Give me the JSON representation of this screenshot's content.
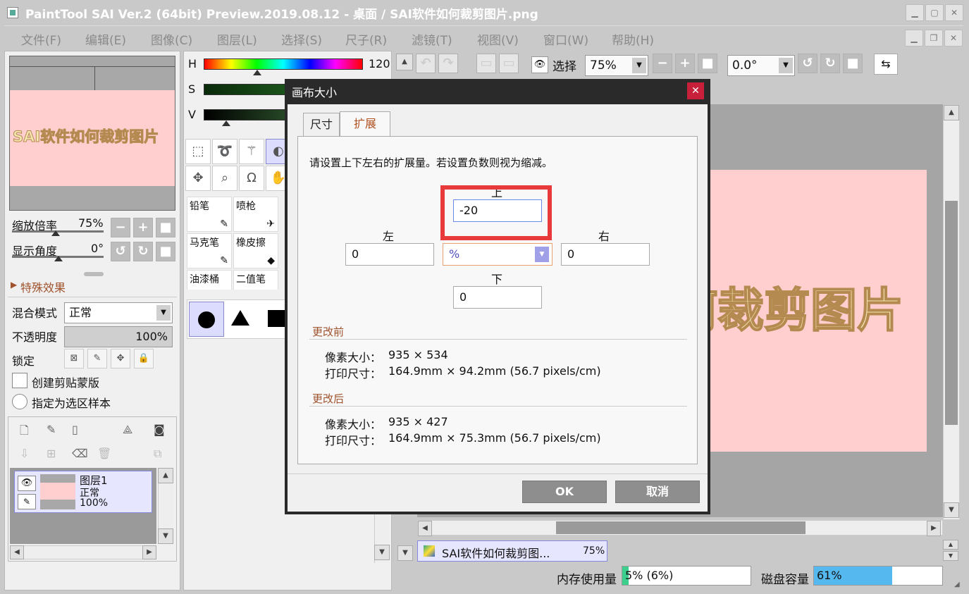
{
  "window": {
    "title": "PaintTool SAI Ver.2 (64bit) Preview.2019.08.12 - 桌面 / SAI软件如何裁剪图片.png"
  },
  "menu": [
    "文件(F)",
    "编辑(E)",
    "图像(C)",
    "图层(L)",
    "选择(S)",
    "尺子(R)",
    "滤镜(T)",
    "视图(V)",
    "窗口(W)",
    "帮助(H)"
  ],
  "navigator": {
    "preview_text": "SAI软件如何裁剪图片",
    "zoom_label": "缩放倍率",
    "zoom_value": "75%",
    "angle_label": "显示角度",
    "angle_value": "0°"
  },
  "effects_label": "特殊效果",
  "layer_props": {
    "blend_label": "混合模式",
    "blend_value": "正常",
    "opacity_label": "不透明度",
    "opacity_value": "100%",
    "opacity_level": 1.0,
    "lock_label": "锁定",
    "clip_label": "创建剪贴蒙版",
    "sample_label": "指定为选区样本"
  },
  "layer": {
    "name": "图层1",
    "mode": "正常",
    "opacity": "100%"
  },
  "color": {
    "h_label": "H",
    "h_value": "120",
    "s_label": "S",
    "v_label": "V"
  },
  "brushes": [
    {
      "name": "铅笔"
    },
    {
      "name": "喷枪"
    },
    {
      "name": "马克笔"
    },
    {
      "name": "橡皮擦"
    },
    {
      "name": "油漆桶"
    },
    {
      "name": "二值笔"
    }
  ],
  "toolbar": {
    "select_label": "选择",
    "zoom_value": "75%",
    "angle_value": "0.0°"
  },
  "doc_tab": {
    "name": "SAI软件如何裁剪图...",
    "zoom": "75%"
  },
  "canvas_text": "何裁剪图片",
  "status": {
    "memory_label": "内存使用量",
    "memory_value": "5% (6%)",
    "memory_level": 0.05,
    "disk_label": "磁盘容量",
    "disk_value": "61%",
    "disk_level": 0.61
  },
  "dialog": {
    "title": "画布大小",
    "tab_size": "尺寸",
    "tab_expand": "扩展",
    "instruction": "请设置上下左右的扩展量。若设置负数则视为缩减。",
    "top_label": "上",
    "top_value": "-20",
    "left_label": "左",
    "left_value": "0",
    "right_label": "右",
    "right_value": "0",
    "bottom_label": "下",
    "bottom_value": "0",
    "unit": "%",
    "before_label": "更改前",
    "after_label": "更改后",
    "pixel_label": "像素大小：",
    "print_label": "打印尺寸：",
    "before_pixel": "935 × 534",
    "before_print": "164.9mm × 94.2mm (56.7 pixels/cm)",
    "after_pixel": "935 × 427",
    "after_print": "164.9mm × 75.3mm (56.7 pixels/cm)",
    "ok": "OK",
    "cancel": "取消"
  },
  "colors": {
    "highlight": "#e83a3a",
    "dialog_border": "#2a2a2a",
    "disk_bar": "#55b8ee",
    "mem_bar": "#3ccf8e"
  }
}
